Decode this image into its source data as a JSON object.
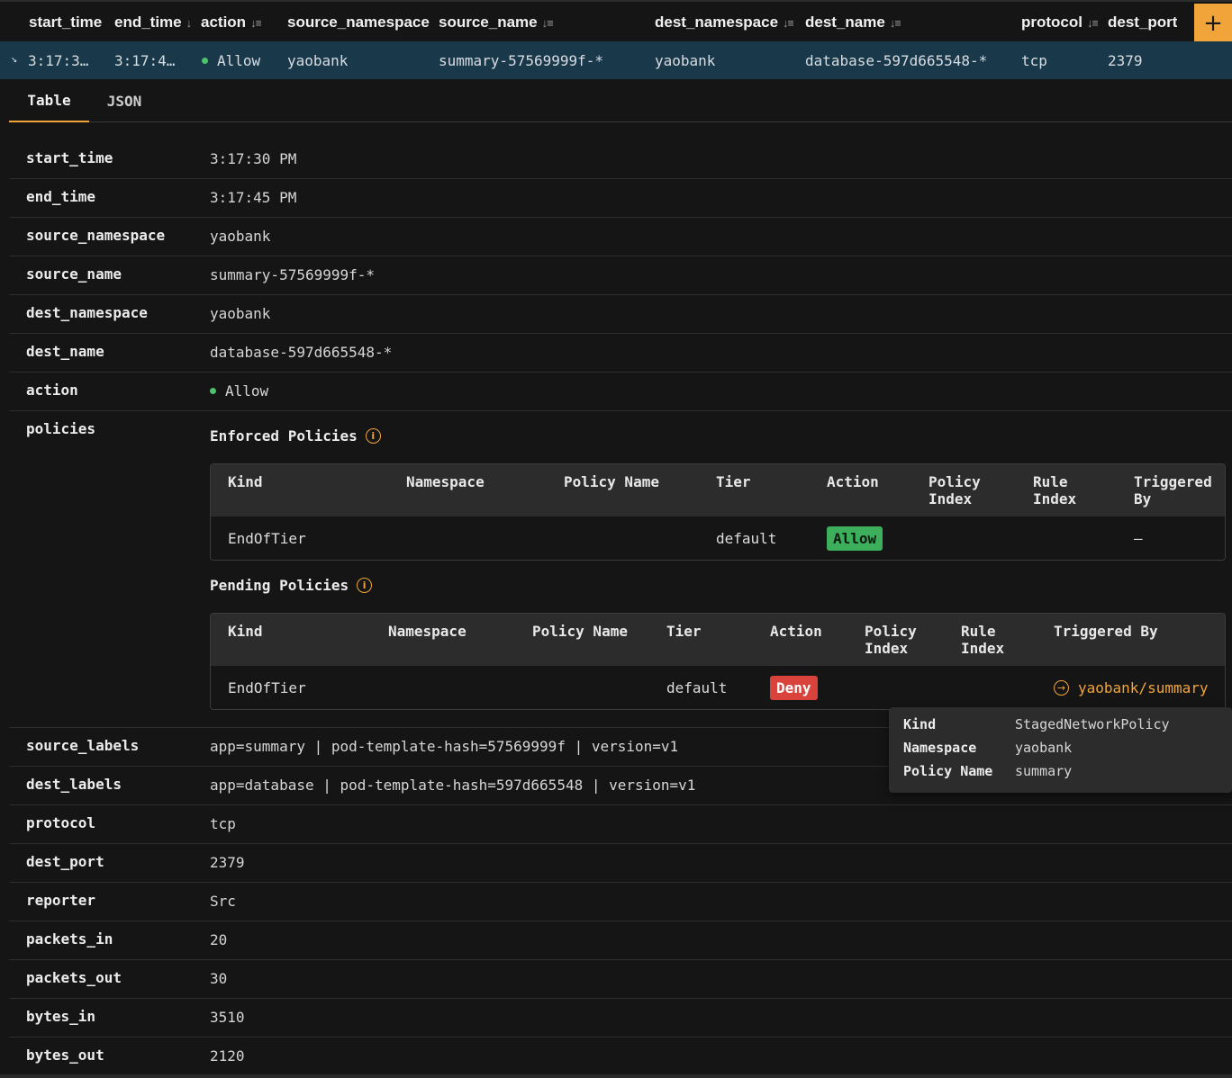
{
  "columns": {
    "start_time": "start_time",
    "end_time": "end_time",
    "action": "action",
    "source_namespace": "source_namespace",
    "source_name": "source_name",
    "dest_namespace": "dest_namespace",
    "dest_name": "dest_name",
    "protocol": "protocol",
    "dest_port": "dest_port",
    "add_label": "+"
  },
  "selected_row": {
    "start_time": "3:17:3…",
    "end_time": "3:17:4…",
    "action": "Allow",
    "source_namespace": "yaobank",
    "source_name": "summary-57569999f-*",
    "dest_namespace": "yaobank",
    "dest_name": "database-597d665548-*",
    "protocol": "tcp",
    "dest_port": "2379"
  },
  "tabs": {
    "table": "Table",
    "json": "JSON"
  },
  "details": {
    "start_time": {
      "label": "start_time",
      "value": "3:17:30 PM"
    },
    "end_time": {
      "label": "end_time",
      "value": "3:17:45 PM"
    },
    "source_namespace": {
      "label": "source_namespace",
      "value": "yaobank"
    },
    "source_name": {
      "label": "source_name",
      "value": "summary-57569999f-*"
    },
    "dest_namespace": {
      "label": "dest_namespace",
      "value": "yaobank"
    },
    "dest_name": {
      "label": "dest_name",
      "value": "database-597d665548-*"
    },
    "action": {
      "label": "action",
      "value": "Allow"
    },
    "policies": {
      "label": "policies"
    },
    "source_labels": {
      "label": "source_labels",
      "value": "app=summary | pod-template-hash=57569999f | version=v1"
    },
    "dest_labels": {
      "label": "dest_labels",
      "value": "app=database | pod-template-hash=597d665548 | version=v1"
    },
    "protocol": {
      "label": "protocol",
      "value": "tcp"
    },
    "dest_port": {
      "label": "dest_port",
      "value": "2379"
    },
    "reporter": {
      "label": "reporter",
      "value": "Src"
    },
    "packets_in": {
      "label": "packets_in",
      "value": "20"
    },
    "packets_out": {
      "label": "packets_out",
      "value": "30"
    },
    "bytes_in": {
      "label": "bytes_in",
      "value": "3510"
    },
    "bytes_out": {
      "label": "bytes_out",
      "value": "2120"
    }
  },
  "enforced": {
    "title": "Enforced Policies",
    "headers": {
      "kind": "Kind",
      "namespace": "Namespace",
      "policy_name": "Policy Name",
      "tier": "Tier",
      "action": "Action",
      "policy_index_1": "Policy",
      "policy_index_2": "Index",
      "rule_index_1": "Rule",
      "rule_index_2": "Index",
      "triggered_by_1": "Triggered",
      "triggered_by_2": "By"
    },
    "row": {
      "kind": "EndOfTier",
      "tier": "default",
      "action": "Allow",
      "triggered_by": "–"
    }
  },
  "pending": {
    "title": "Pending Policies",
    "headers": {
      "kind": "Kind",
      "namespace": "Namespace",
      "policy_name": "Policy Name",
      "tier": "Tier",
      "action": "Action",
      "policy_index_1": "Policy",
      "policy_index_2": "Index",
      "rule_index_1": "Rule",
      "rule_index_2": "Index",
      "triggered_by": "Triggered By"
    },
    "row": {
      "kind": "EndOfTier",
      "tier": "default",
      "action": "Deny",
      "triggered_by": "yaobank/summary"
    }
  },
  "tooltip": {
    "kind_label": "Kind",
    "kind_value": "StagedNetworkPolicy",
    "namespace_label": "Namespace",
    "namespace_value": "yaobank",
    "policy_name_label": "Policy Name",
    "policy_name_value": "summary"
  },
  "colors": {
    "accent": "#f0a43a",
    "allow": "#3cae5c",
    "deny": "#d9433b",
    "selected_row": "#19384a"
  }
}
